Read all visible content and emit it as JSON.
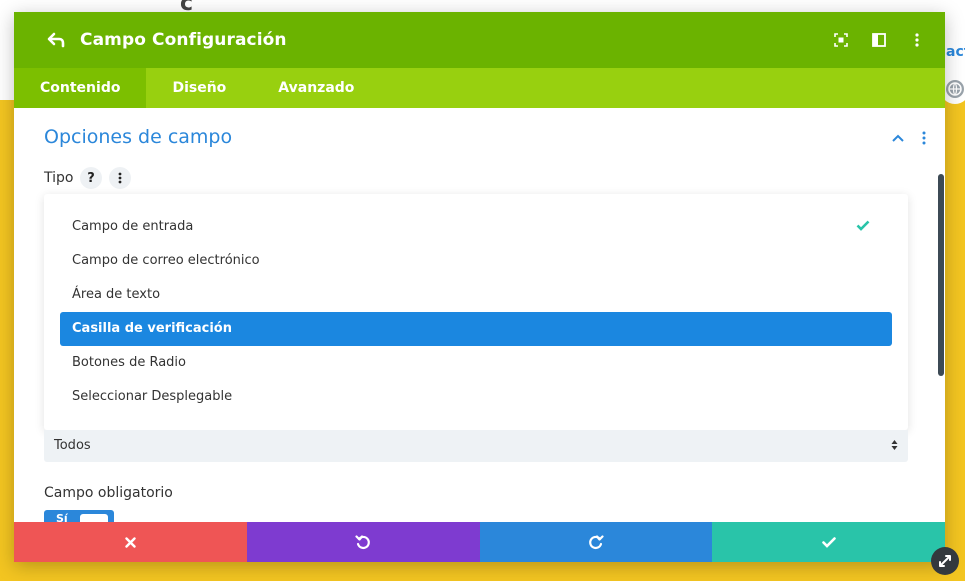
{
  "background": {
    "logo_fragment": "c´",
    "link_fragment": "act"
  },
  "header": {
    "title": "Campo Configuración"
  },
  "tabs": [
    {
      "label": "Contenido",
      "active": true
    },
    {
      "label": "Diseño",
      "active": false
    },
    {
      "label": "Avanzado",
      "active": false
    }
  ],
  "section": {
    "title": "Opciones de campo"
  },
  "tipo": {
    "label": "Tipo",
    "help_glyph": "?",
    "options": [
      {
        "label": "Campo de entrada",
        "checked": true,
        "highlighted": false
      },
      {
        "label": "Campo de correo electrónico",
        "checked": false,
        "highlighted": false
      },
      {
        "label": "Área de texto",
        "checked": false,
        "highlighted": false
      },
      {
        "label": "Casilla de verificación",
        "checked": false,
        "highlighted": true
      },
      {
        "label": "Botones de Radio",
        "checked": false,
        "highlighted": false
      },
      {
        "label": "Seleccionar Desplegable",
        "checked": false,
        "highlighted": false
      }
    ]
  },
  "select": {
    "value": "Todos"
  },
  "required": {
    "label": "Campo obligatorio",
    "toggle_label": "Sí"
  },
  "colors": {
    "header": "#6bb300",
    "tabs": "#98d00f",
    "tab_active": "#7cbf00",
    "accent_blue": "#2b87da",
    "highlight": "#1b87e0",
    "check": "#29c4a9",
    "cancel": "#ef5555",
    "undo": "#7e3bd0",
    "redo": "#2b87da",
    "save": "#29c4a9"
  }
}
